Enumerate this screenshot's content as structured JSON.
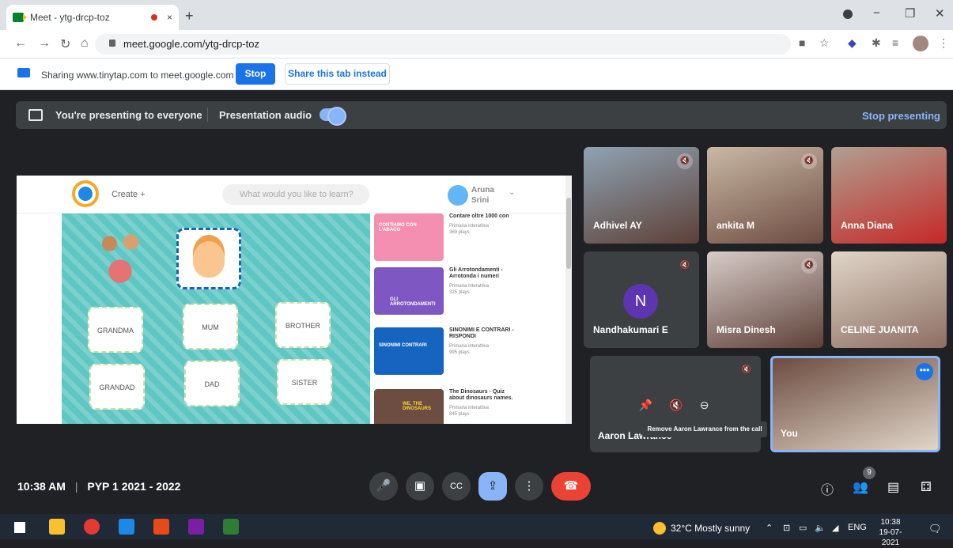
{
  "browser": {
    "tab_title": "Meet - ytg-drcp-toz",
    "tab_close": "×",
    "new_tab": "+",
    "url": "meet.google.com/ytg-drcp-toz",
    "win_min": "−",
    "win_max": "❐",
    "win_close": "✕"
  },
  "share_bar": {
    "text": "Sharing www.tinytap.com to meet.google.com",
    "stop_label": "Stop",
    "share_tab_label": "Share this tab instead"
  },
  "presenting": {
    "status": "You're presenting to everyone",
    "audio_label": "Presentation audio",
    "audio_on": true,
    "stop_label": "Stop presenting"
  },
  "shared_site": {
    "create_label": "Create +",
    "search_placeholder": "What would you like to learn?",
    "user_name": "Aruna Srini",
    "cards": [
      "GRANDMA",
      "MUM",
      "BROTHER",
      "GRANDAD",
      "DAD",
      "SISTER"
    ],
    "list": [
      {
        "title": "Contare oltre 1000 con",
        "sub": "Primaria interattiva",
        "plays": "369 plays",
        "thumb_text": "CONTIAMO CON L'ABACO",
        "color": "#f48fb1"
      },
      {
        "title": "Gli Arrotondamenti - Arrotonda i numeri",
        "sub": "Primaria interattiva",
        "plays": "325 plays",
        "thumb_text": "GLI ARROTONDAMENTI",
        "color": "#7e57c2"
      },
      {
        "title": "SINONIMI E CONTRARI - RISPONDI",
        "sub": "Primaria interattiva",
        "plays": "995 plays",
        "thumb_text": "SINONIMI CONTRARI",
        "color": "#1565c0"
      },
      {
        "title": "The Dinosaurs - Quiz about dinosaurs names.",
        "sub": "Primaria interattiva",
        "plays": "845 plays",
        "thumb_text": "WE, THE DINOSAURS",
        "color": "#6d4c41"
      }
    ]
  },
  "participants": [
    {
      "name": "Adhivel AY",
      "bg": "#6d7f8f"
    },
    {
      "name": "ankita M",
      "bg": "#9e8a78"
    },
    {
      "name": "Anna Diana",
      "bg": "#8d6e63"
    },
    {
      "name": "Nandhakumari E",
      "bg": "#3c4043",
      "initial": "N"
    },
    {
      "name": "Misra Dinesh",
      "bg": "#a1887f"
    },
    {
      "name": "CELINE JUANITA",
      "bg": "#c8b9a6"
    },
    {
      "name": "Aaron Lawrance",
      "bg": "#3c4043"
    },
    {
      "name": "You",
      "bg": "#8d6e63"
    }
  ],
  "tooltip": "Remove Aaron Lawrance from the call",
  "hover_controls": [
    "📌",
    "🔇",
    "⊖"
  ],
  "meeting": {
    "time": "10:38 AM",
    "separator": "|",
    "title": "PYP 1 2021 - 2022",
    "people_count": "9"
  },
  "controls": {
    "mic": "🎤",
    "camera": "▣",
    "captions": "CC",
    "present": "⇪",
    "more": "⋮",
    "end": "☎"
  },
  "taskbar": {
    "weather": "32°C  Mostly sunny",
    "lang": "ENG",
    "time": "10:38",
    "date": "19-07-2021"
  }
}
